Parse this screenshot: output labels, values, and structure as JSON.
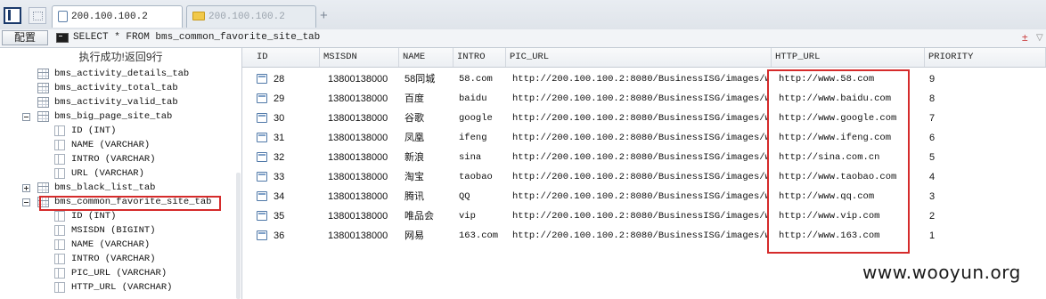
{
  "tabs": [
    {
      "label": "200.100.100.2",
      "active": true,
      "icon": "document-icon"
    },
    {
      "label": "200.100.100.2",
      "active": false,
      "icon": "folder-icon"
    }
  ],
  "new_tab_label": "+",
  "toolbar": {
    "config_label": "配置",
    "sql_icon": "terminal-icon",
    "sql": "SELECT * FROM bms_common_favorite_site_tab",
    "ctrl_a": "±",
    "ctrl_b": "▽"
  },
  "tree": {
    "status": "执行成功!返回9行",
    "items": [
      {
        "label": "bms_activity_details_tab",
        "kind": "table"
      },
      {
        "label": "bms_activity_total_tab",
        "kind": "table"
      },
      {
        "label": "bms_activity_valid_tab",
        "kind": "table"
      },
      {
        "label": "bms_big_page_site_tab",
        "kind": "table",
        "expander": "minus"
      },
      {
        "label": "ID (INT)",
        "kind": "column"
      },
      {
        "label": "NAME (VARCHAR)",
        "kind": "column"
      },
      {
        "label": "INTRO (VARCHAR)",
        "kind": "column"
      },
      {
        "label": "URL (VARCHAR)",
        "kind": "column"
      },
      {
        "label": "bms_black_list_tab",
        "kind": "table",
        "expander": "plus"
      },
      {
        "label": "bms_common_favorite_site_tab",
        "kind": "table",
        "expander": "minus",
        "highlighted": true
      },
      {
        "label": "ID (INT)",
        "kind": "column"
      },
      {
        "label": "MSISDN (BIGINT)",
        "kind": "column"
      },
      {
        "label": "NAME (VARCHAR)",
        "kind": "column"
      },
      {
        "label": "INTRO (VARCHAR)",
        "kind": "column"
      },
      {
        "label": "PIC_URL (VARCHAR)",
        "kind": "column"
      },
      {
        "label": "HTTP_URL (VARCHAR)",
        "kind": "column"
      }
    ]
  },
  "grid": {
    "columns": [
      "ID",
      "MSISDN",
      "NAME",
      "INTRO",
      "PIC_URL",
      "HTTP_URL",
      "PRIORITY"
    ],
    "rows": [
      [
        "28",
        "13800138000",
        "58同城",
        "58.com",
        "http://200.100.100.2:8080/BusinessISG/images/w...",
        "http://www.58.com",
        "9"
      ],
      [
        "29",
        "13800138000",
        "百度",
        "baidu",
        "http://200.100.100.2:8080/BusinessISG/images/w...",
        "http://www.baidu.com",
        "8"
      ],
      [
        "30",
        "13800138000",
        "谷歌",
        "google",
        "http://200.100.100.2:8080/BusinessISG/images/w...",
        "http://www.google.com",
        "7"
      ],
      [
        "31",
        "13800138000",
        "凤凰",
        "ifeng",
        "http://200.100.100.2:8080/BusinessISG/images/w...",
        "http://www.ifeng.com",
        "6"
      ],
      [
        "32",
        "13800138000",
        "新浪",
        "sina",
        "http://200.100.100.2:8080/BusinessISG/images/w...",
        "http://sina.com.cn",
        "5"
      ],
      [
        "33",
        "13800138000",
        "淘宝",
        "taobao",
        "http://200.100.100.2:8080/BusinessISG/images/w...",
        "http://www.taobao.com",
        "4"
      ],
      [
        "34",
        "13800138000",
        "腾讯",
        "QQ",
        "http://200.100.100.2:8080/BusinessISG/images/w...",
        "http://www.qq.com",
        "3"
      ],
      [
        "35",
        "13800138000",
        "唯品会",
        "vip",
        "http://200.100.100.2:8080/BusinessISG/images/w...",
        "http://www.vip.com",
        "2"
      ],
      [
        "36",
        "13800138000",
        "网易",
        "163.com",
        "http://200.100.100.2:8080/BusinessISG/images/w...",
        "http://www.163.com",
        "1"
      ]
    ],
    "highlight_color": "#d52b2b"
  },
  "watermark": "www.wooyun.org"
}
